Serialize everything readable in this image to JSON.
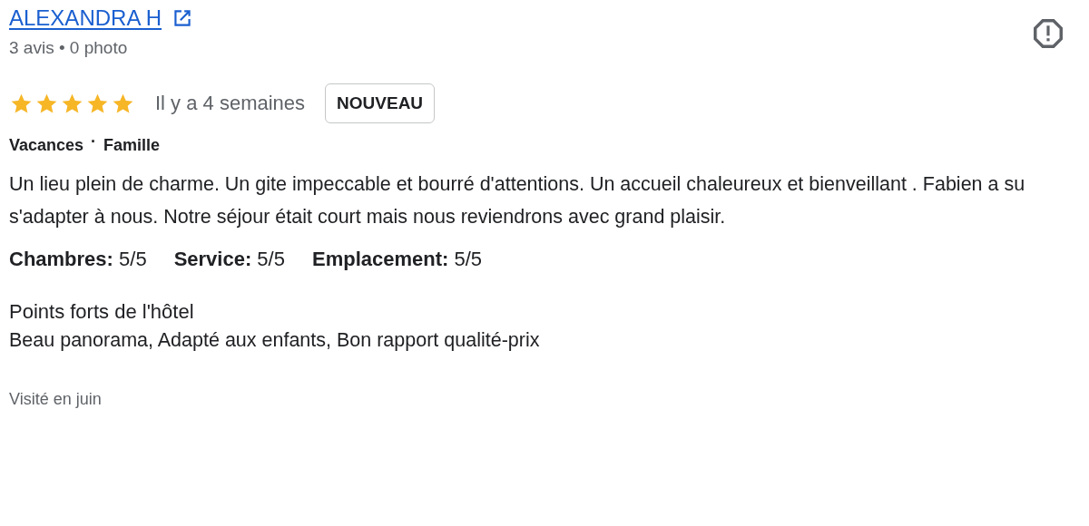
{
  "reviewer": {
    "name": "ALEXANDRA H",
    "meta": "3 avis • 0 photo"
  },
  "review": {
    "stars": 5,
    "date": "Il y a 4 semaines",
    "badge": "NOUVEAU",
    "trip": [
      "Vacances",
      "Famille"
    ],
    "trip_separator": "·",
    "text": "Un lieu plein de charme. Un gite impeccable et bourré d'attentions. Un accueil chaleureux et bienveillant . Fabien a su s'adapter à nous. Notre séjour était court mais nous reviendrons avec grand plaisir.",
    "ratings": [
      "**Chambres:** 5/5",
      "**Service:** 5/5",
      "**Emplacement:** 5/5"
    ],
    "highlights_title": "Points forts de l'hôtel",
    "highlights": "Beau panorama, Adapté aux enfants, Bon rapport qualité-prix",
    "visited": "Visité en juin"
  }
}
